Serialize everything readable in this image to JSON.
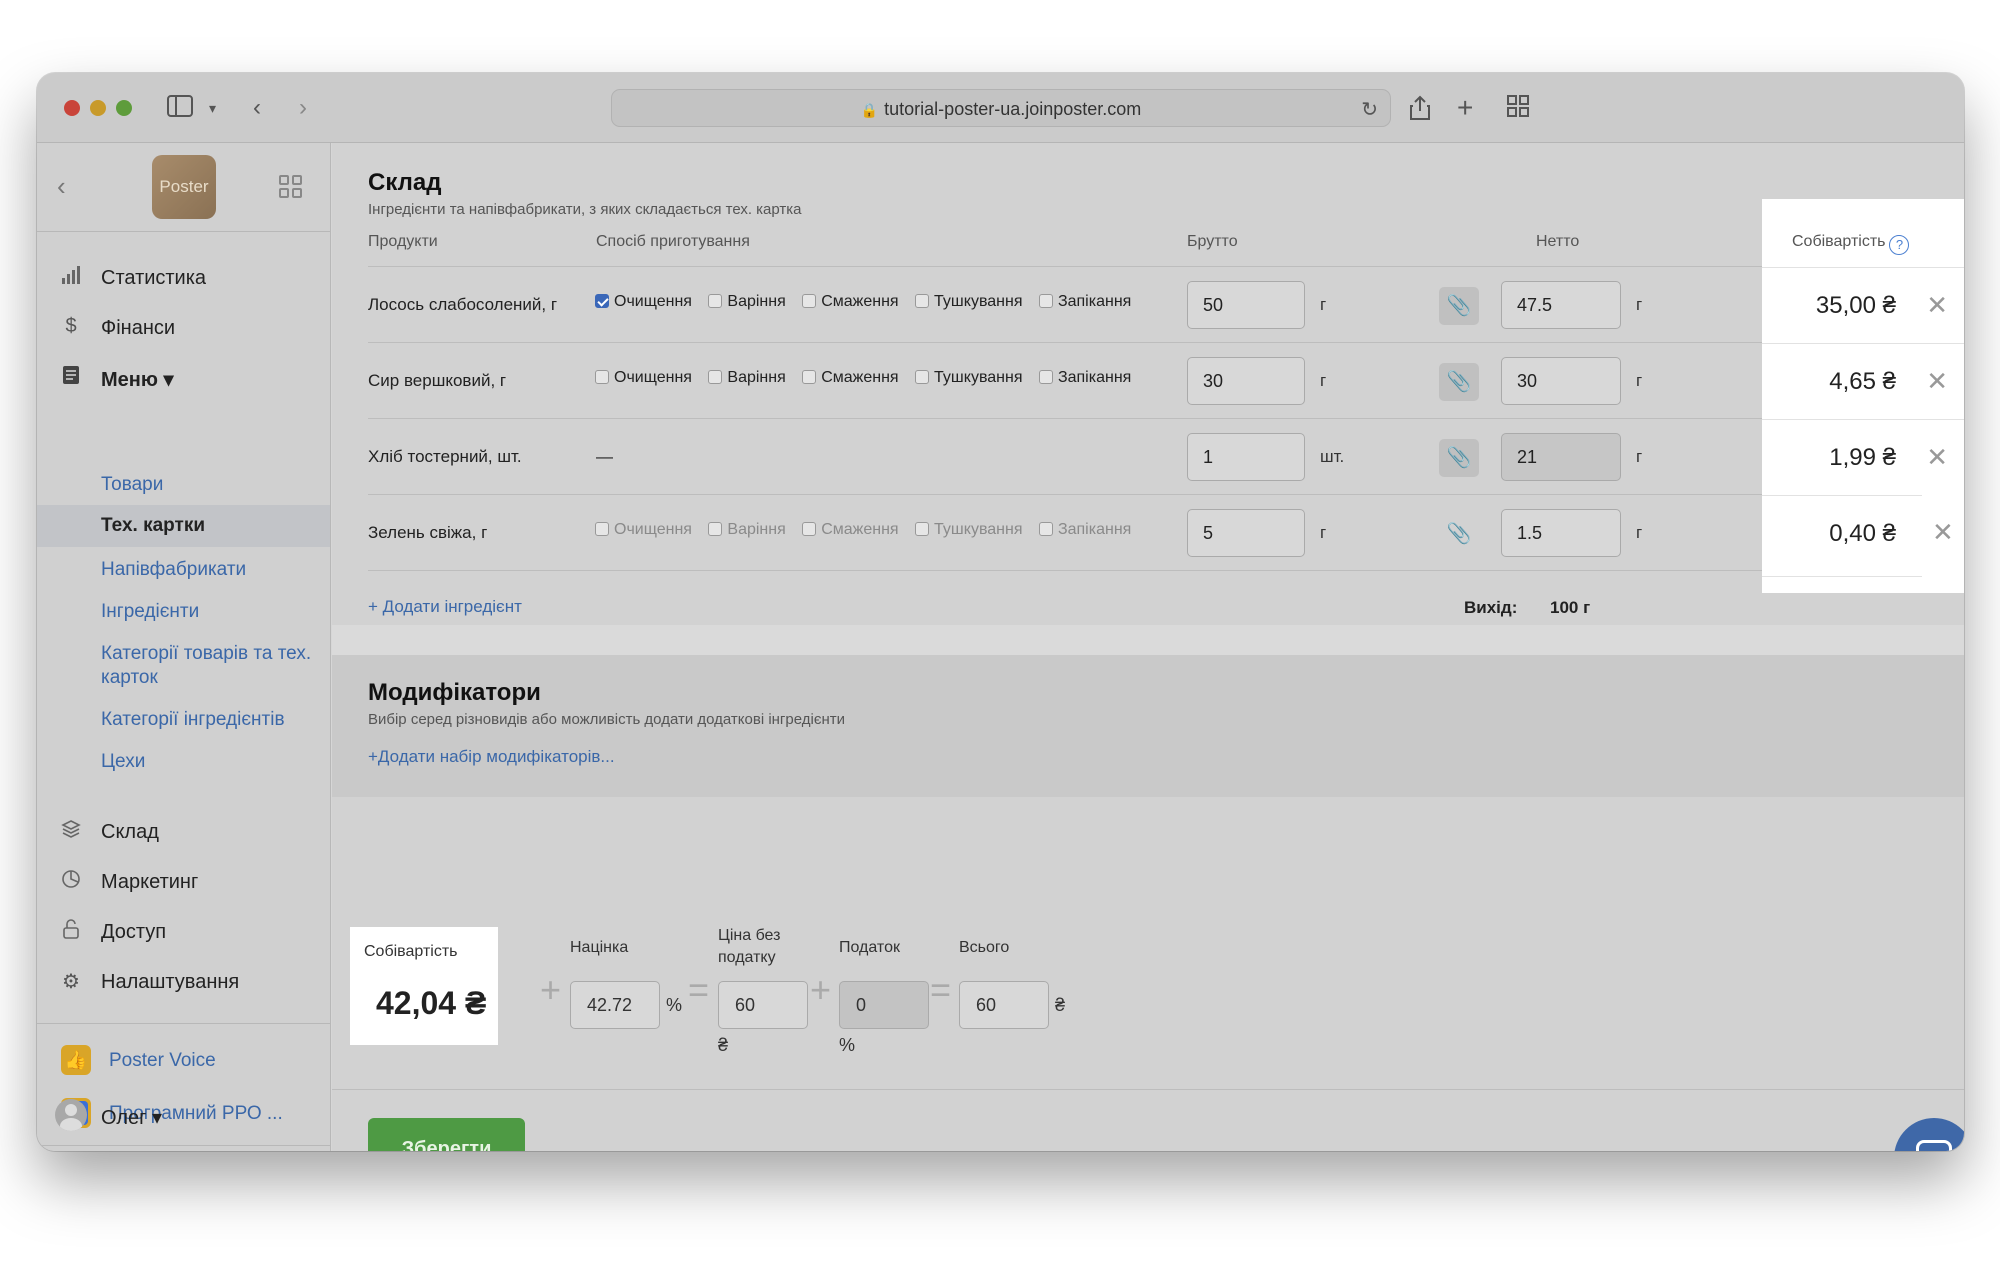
{
  "browser": {
    "url": "tutorial-poster-ua.joinposter.com"
  },
  "sidebar": {
    "logo": "Poster",
    "nav": [
      {
        "label": "Статистика"
      },
      {
        "label": "Фінанси"
      },
      {
        "label": "Меню ▾"
      }
    ],
    "menu_sub": [
      "Товари",
      "Тех. картки",
      "Напівфабрикати",
      "Інгредієнти",
      "Категорії товарів та тех. карток",
      "Категорії інгредієнтів",
      "Цехи"
    ],
    "nav2": [
      {
        "label": "Склад"
      },
      {
        "label": "Маркетинг"
      },
      {
        "label": "Доступ"
      },
      {
        "label": "Налаштування"
      }
    ],
    "apps": [
      {
        "label": "Poster Voice"
      },
      {
        "label": "Програмний РРО ..."
      }
    ],
    "user": "Олег ▾"
  },
  "sklad": {
    "title": "Склад",
    "subtitle": "Інгредієнти та напівфабрикати, з яких складається тех. картка",
    "col_products": "Продукти",
    "col_method": "Спосіб приготування",
    "col_brutto": "Брутто",
    "col_netto": "Нетто",
    "col_cost": "Собівартість",
    "methods": [
      "Очищення",
      "Варіння",
      "Смаження",
      "Тушкування",
      "Запікання"
    ],
    "rows": [
      {
        "name": "Лосось слабосолений, г",
        "brutto": "50",
        "brutto_unit": "г",
        "netto": "47.5",
        "netto_unit": "г",
        "cost": "35,00 ₴"
      },
      {
        "name": "Сир вершковий, г",
        "brutto": "30",
        "brutto_unit": "г",
        "netto": "30",
        "netto_unit": "г",
        "cost": "4,65 ₴"
      },
      {
        "name": "Хліб тостерний, шт.",
        "dash": "—",
        "brutto": "1",
        "brutto_unit": "шт.",
        "netto": "21",
        "netto_unit": "г",
        "cost": "1,99 ₴"
      },
      {
        "name": "Зелень свіжа, г",
        "brutto": "5",
        "brutto_unit": "г",
        "netto": "1.5",
        "netto_unit": "г",
        "cost": "0,40 ₴"
      }
    ],
    "add_ingredient": "+ Додати інгредієнт",
    "yield_label": "Вихід:",
    "yield_value": "100 г"
  },
  "modifiers": {
    "title": "Модифікатори",
    "subtitle": "Вибір серед різновидів або можливість додати додаткові інгредієнти",
    "add": "+Додати набір модифікаторів..."
  },
  "summary": {
    "cost_label": "Собівартість",
    "cost_value": "42,04 ₴",
    "markup_label": "Націнка",
    "markup_value": "42.72",
    "markup_unit": "%",
    "price_label_1": "Ціна без",
    "price_label_2": "податку",
    "price_value": "60",
    "price_unit": "₴",
    "tax_label": "Податок",
    "tax_value": "0",
    "tax_unit": "%",
    "total_label": "Всього",
    "total_value": "60",
    "total_unit": "₴"
  },
  "actions": {
    "save": "Зберегти"
  }
}
